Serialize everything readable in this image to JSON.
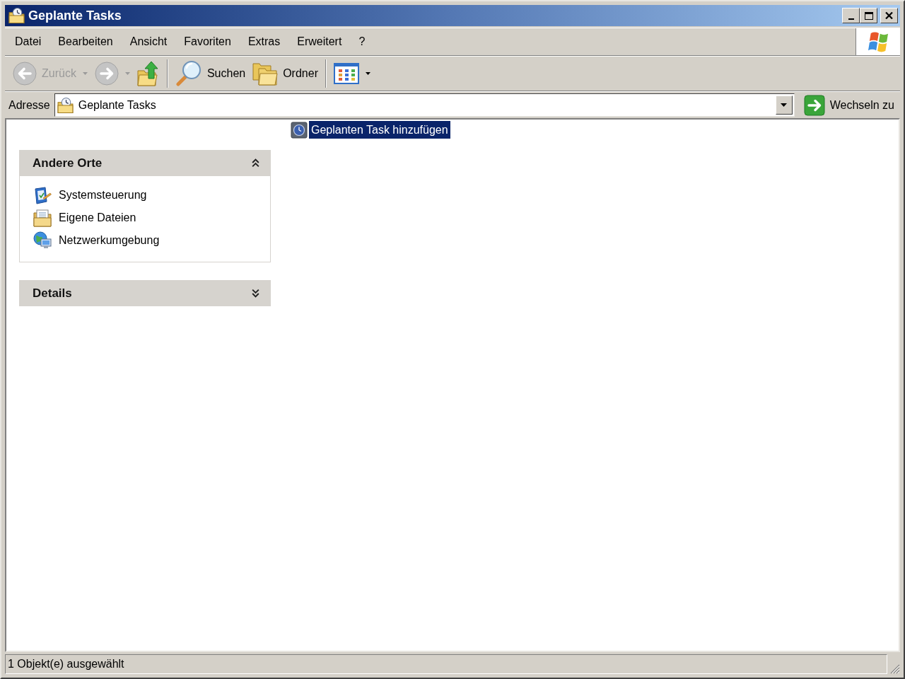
{
  "window": {
    "title": "Geplante Tasks"
  },
  "menu": [
    {
      "label": "Datei"
    },
    {
      "label": "Bearbeiten"
    },
    {
      "label": "Ansicht"
    },
    {
      "label": "Favoriten"
    },
    {
      "label": "Extras"
    },
    {
      "label": "Erweitert"
    },
    {
      "label": "?"
    }
  ],
  "toolbar": [
    {
      "kind": "back",
      "label": "Zurück",
      "disabled": true,
      "dropdown": true
    },
    {
      "kind": "forward",
      "disabled": true,
      "dropdown": true
    },
    {
      "kind": "up"
    },
    {
      "kind": "separator"
    },
    {
      "kind": "search",
      "label": "Suchen"
    },
    {
      "kind": "folders",
      "label": "Ordner"
    },
    {
      "kind": "separator"
    },
    {
      "kind": "views",
      "dropdown": true
    }
  ],
  "address_bar": {
    "label": "Adresse",
    "value": "Geplante Tasks",
    "go_label": "Wechseln zu"
  },
  "task_pane": [
    {
      "title": "Andere Orte",
      "expanded": true,
      "items": [
        {
          "kind": "control-panel",
          "label": "Systemsteuerung"
        },
        {
          "kind": "documents",
          "label": "Eigene Dateien"
        },
        {
          "kind": "network",
          "label": "Netzwerkumgebung"
        }
      ]
    },
    {
      "title": "Details",
      "expanded": false
    }
  ],
  "files": [
    {
      "name": "Geplanten Task hinzufügen",
      "selected": true
    }
  ],
  "status_bar": {
    "text": "1 Objekt(e) ausgewählt"
  }
}
